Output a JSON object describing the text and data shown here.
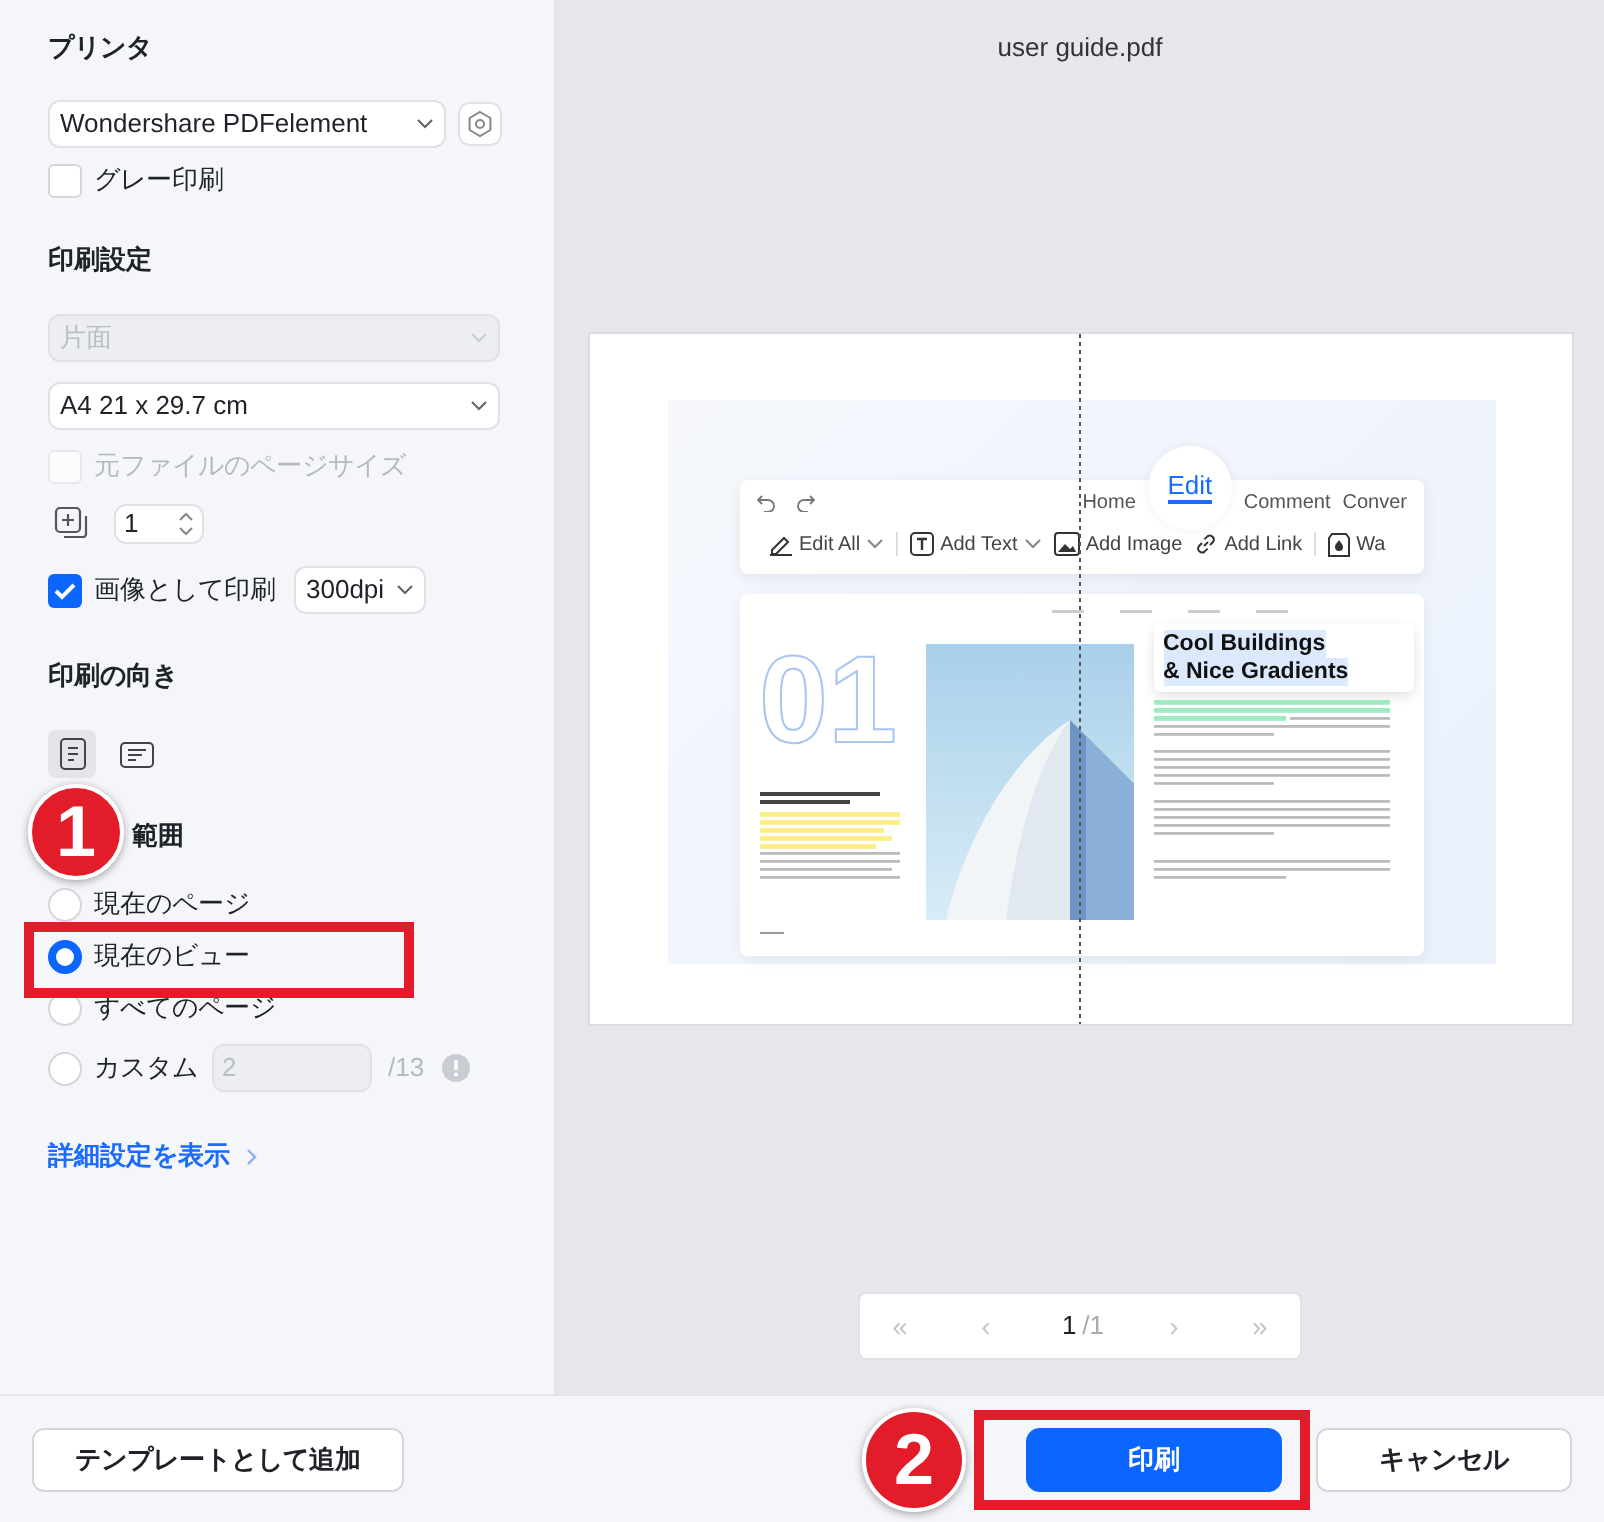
{
  "printer": {
    "heading": "プリンタ",
    "device": "Wondershare PDFelement",
    "grayscale": {
      "label": "グレー印刷",
      "checked": false
    }
  },
  "settings": {
    "heading": "印刷設定",
    "duplex": {
      "value": "片面",
      "disabled": true
    },
    "paper_size": "A4 21 x 29.7 cm",
    "original_size": {
      "label": "元ファイルのページサイズ",
      "checked": false,
      "disabled": true
    },
    "copies": "1",
    "as_image": {
      "label": "画像として印刷",
      "checked": true
    },
    "dpi": "300dpi"
  },
  "orientation": {
    "heading": "印刷の向き",
    "options": [
      {
        "kind": "portrait",
        "selected": true
      },
      {
        "kind": "landscape",
        "selected": false
      }
    ]
  },
  "range": {
    "heading": "範囲",
    "options": [
      {
        "kind": "plain",
        "label": "現在のページ",
        "selected": false
      },
      {
        "kind": "plain",
        "label": "現在のビュー",
        "selected": true
      },
      {
        "kind": "plain",
        "label": "すべてのページ",
        "selected": false
      },
      {
        "kind": "custom",
        "label": "カスタム",
        "selected": false
      }
    ],
    "custom_value": "2",
    "total": "/13"
  },
  "advanced_link": "詳細設定を表示",
  "preview": {
    "title": "user guide.pdf",
    "document": {
      "tabs": [
        {
          "label": "Home",
          "selected": false
        },
        {
          "label": "Edit",
          "selected": true
        },
        {
          "label": "Comment",
          "selected": false
        },
        {
          "label": "Conver",
          "selected": false
        }
      ],
      "tools": [
        {
          "label": "Edit All",
          "dropdown": true
        },
        {
          "label": "Add Text",
          "dropdown": true
        },
        {
          "label": "Add Image",
          "dropdown": false
        },
        {
          "label": "Add Link",
          "dropdown": false
        },
        {
          "label": "Wa",
          "dropdown": false
        }
      ],
      "big_number": "01",
      "headline": [
        "Cool Buildings",
        "& Nice Gradients"
      ]
    },
    "pager": {
      "first": "«",
      "prev": "‹",
      "current": "1",
      "total": "/1",
      "next": "›",
      "last": "»"
    }
  },
  "footer": {
    "template_button": "テンプレートとして追加",
    "print_button": "印刷",
    "cancel_button": "キャンセル"
  },
  "annotations": [
    {
      "number": "1"
    },
    {
      "number": "2"
    }
  ]
}
